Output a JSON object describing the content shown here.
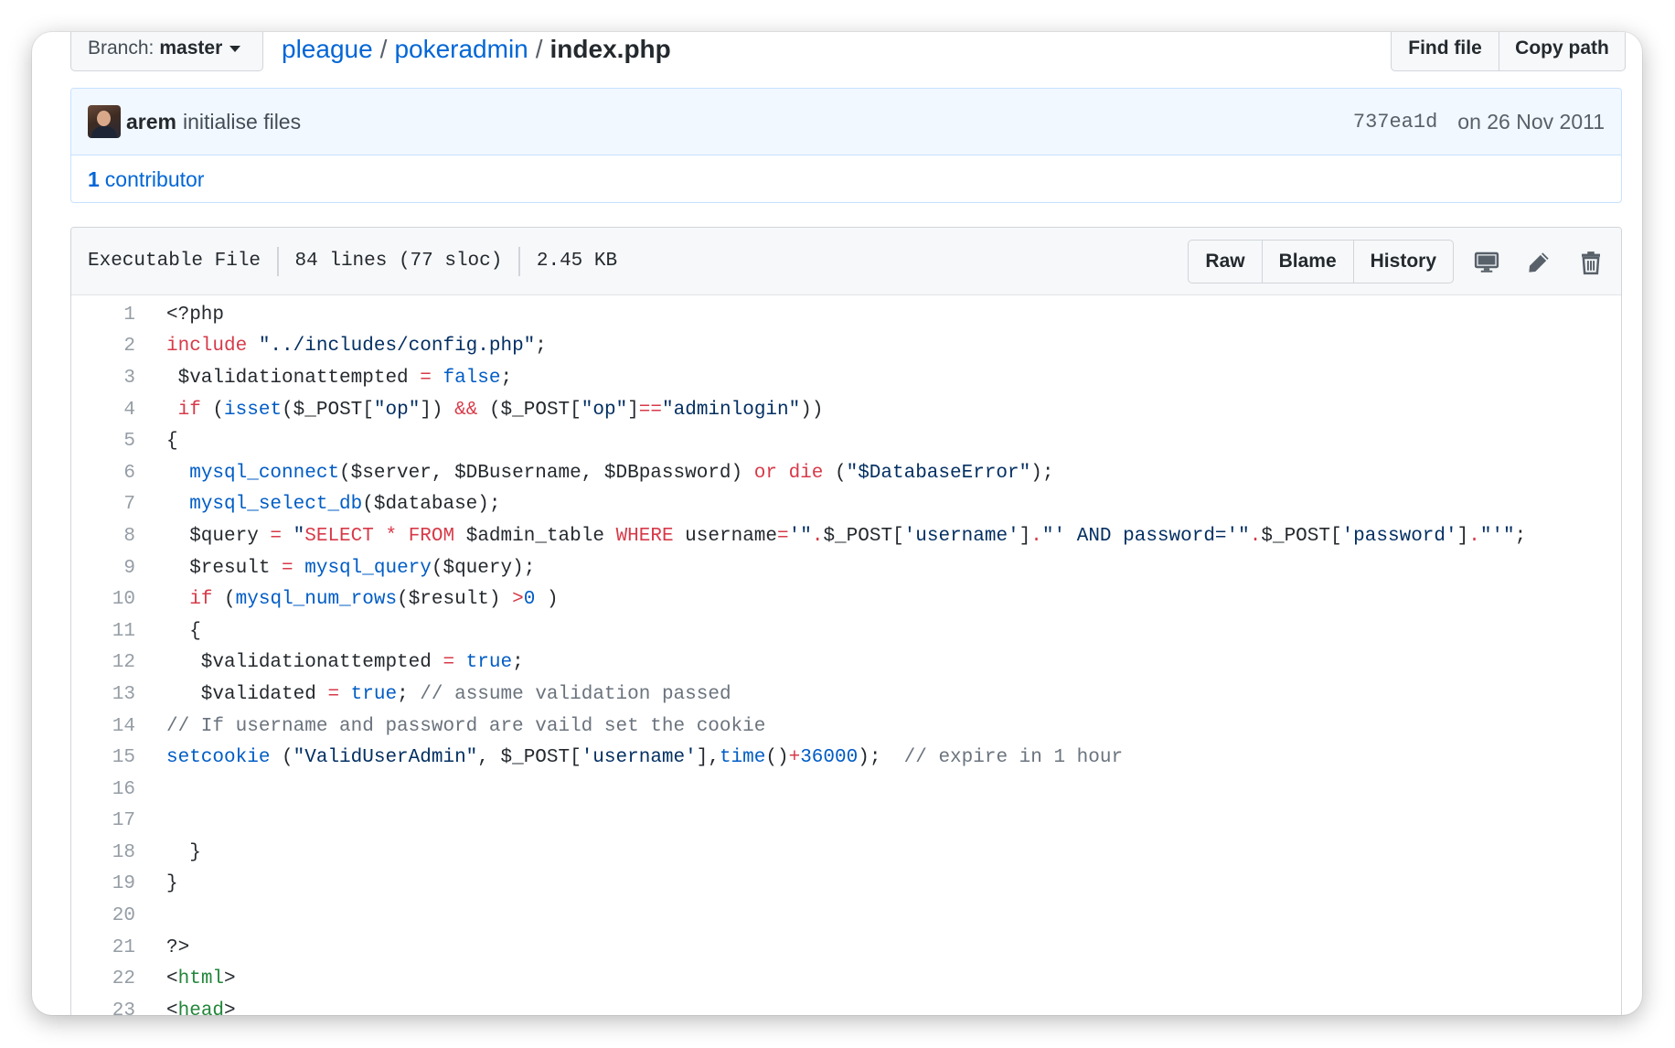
{
  "top": {
    "branch_label": "Branch:",
    "branch_value": "master",
    "breadcrumb_owner": "pleague",
    "breadcrumb_sep1": "/",
    "breadcrumb_repo": "pokeradmin",
    "breadcrumb_sep2": "/",
    "breadcrumb_file": "index.php",
    "find_file": "Find file",
    "copy_path": "Copy path"
  },
  "commit": {
    "author": "arem",
    "message": "initialise files",
    "sha": "737ea1d",
    "date": "on 26 Nov 2011",
    "contributors_count": "1",
    "contributors_label": "contributor"
  },
  "file": {
    "type": "Executable File",
    "lines": "84 lines (77 sloc)",
    "size": "2.45 KB",
    "raw": "Raw",
    "blame": "Blame",
    "history": "History",
    "icons": [
      "desktop-icon",
      "pencil-icon",
      "trash-icon"
    ]
  },
  "colors": {
    "keyword": "#d73a49",
    "entity": "#005cc5",
    "string": "#032f62",
    "comment": "#6a737d",
    "tag": "#22863a",
    "link": "#0366d6"
  },
  "code_lines": [
    {
      "n": "1",
      "tokens": [
        [
          "",
          "<?php"
        ]
      ]
    },
    {
      "n": "2",
      "tokens": [
        [
          "k",
          "include"
        ],
        [
          "",
          " "
        ],
        [
          "s",
          "\"../includes/config.php\""
        ],
        [
          "",
          ";"
        ]
      ]
    },
    {
      "n": "3",
      "tokens": [
        [
          "",
          " $validationattempted "
        ],
        [
          "k",
          "="
        ],
        [
          "",
          " "
        ],
        [
          "e",
          "false"
        ],
        [
          "",
          ";"
        ]
      ]
    },
    {
      "n": "4",
      "tokens": [
        [
          "",
          " "
        ],
        [
          "k",
          "if"
        ],
        [
          "",
          " ("
        ],
        [
          "e",
          "isset"
        ],
        [
          "",
          "($_POST["
        ],
        [
          "s",
          "\"op\""
        ],
        [
          "",
          "]) "
        ],
        [
          "k",
          "&&"
        ],
        [
          "",
          " ($_POST["
        ],
        [
          "s",
          "\"op\""
        ],
        [
          "",
          "]"
        ],
        [
          "k",
          "=="
        ],
        [
          "s",
          "\"adminlogin\""
        ],
        [
          "",
          "))"
        ]
      ]
    },
    {
      "n": "5",
      "tokens": [
        [
          "",
          "{"
        ]
      ]
    },
    {
      "n": "6",
      "tokens": [
        [
          "",
          "  "
        ],
        [
          "e",
          "mysql_connect"
        ],
        [
          "",
          "($server, $DBusername, $DBpassword) "
        ],
        [
          "k",
          "or"
        ],
        [
          "",
          " "
        ],
        [
          "k",
          "die"
        ],
        [
          "",
          " ("
        ],
        [
          "s",
          "\"$DatabaseError\""
        ],
        [
          "",
          ");"
        ]
      ]
    },
    {
      "n": "7",
      "tokens": [
        [
          "",
          "  "
        ],
        [
          "e",
          "mysql_select_db"
        ],
        [
          "",
          "($database);"
        ]
      ]
    },
    {
      "n": "8",
      "tokens": [
        [
          "",
          "  $query "
        ],
        [
          "k",
          "="
        ],
        [
          "",
          " "
        ],
        [
          "s",
          "\""
        ],
        [
          "k",
          "SELECT"
        ],
        [
          "",
          " "
        ],
        [
          "k",
          "*"
        ],
        [
          "",
          " "
        ],
        [
          "k",
          "FROM"
        ],
        [
          "",
          " $admin_table "
        ],
        [
          "k",
          "WHERE"
        ],
        [
          "",
          " username"
        ],
        [
          "k",
          "="
        ],
        [
          "s",
          "'\""
        ],
        [
          "k",
          "."
        ],
        [
          "",
          "$_POST["
        ],
        [
          "s",
          "'username'"
        ],
        [
          "",
          "]"
        ],
        [
          "k",
          "."
        ],
        [
          "s",
          "\"' AND password='\""
        ],
        [
          "k",
          "."
        ],
        [
          "",
          "$_POST["
        ],
        [
          "s",
          "'password'"
        ],
        [
          "",
          "]"
        ],
        [
          "k",
          "."
        ],
        [
          "s",
          "\"'\""
        ],
        [
          "",
          ";"
        ]
      ]
    },
    {
      "n": "9",
      "tokens": [
        [
          "",
          "  $result "
        ],
        [
          "k",
          "="
        ],
        [
          "",
          " "
        ],
        [
          "e",
          "mysql_query"
        ],
        [
          "",
          "($query);"
        ]
      ]
    },
    {
      "n": "10",
      "tokens": [
        [
          "",
          "  "
        ],
        [
          "k",
          "if"
        ],
        [
          "",
          " ("
        ],
        [
          "e",
          "mysql_num_rows"
        ],
        [
          "",
          "($result) "
        ],
        [
          "k",
          ">"
        ],
        [
          "e",
          "0"
        ],
        [
          "",
          " )"
        ]
      ]
    },
    {
      "n": "11",
      "tokens": [
        [
          "",
          "  {"
        ]
      ]
    },
    {
      "n": "12",
      "tokens": [
        [
          "",
          "   $validationattempted "
        ],
        [
          "k",
          "="
        ],
        [
          "",
          " "
        ],
        [
          "e",
          "true"
        ],
        [
          "",
          ";"
        ]
      ]
    },
    {
      "n": "13",
      "tokens": [
        [
          "",
          "   $validated "
        ],
        [
          "k",
          "="
        ],
        [
          "",
          " "
        ],
        [
          "e",
          "true"
        ],
        [
          "",
          "; "
        ],
        [
          "c",
          "// assume validation passed"
        ]
      ]
    },
    {
      "n": "14",
      "tokens": [
        [
          "c",
          "// If username and password are vaild set the cookie"
        ]
      ]
    },
    {
      "n": "15",
      "tokens": [
        [
          "e",
          "setcookie"
        ],
        [
          "",
          " ("
        ],
        [
          "s",
          "\"ValidUserAdmin\""
        ],
        [
          "",
          ", $_POST["
        ],
        [
          "s",
          "'username'"
        ],
        [
          "",
          "],"
        ],
        [
          "e",
          "time"
        ],
        [
          "",
          "()"
        ],
        [
          "k",
          "+"
        ],
        [
          "e",
          "36000"
        ],
        [
          "",
          ");  "
        ],
        [
          "c",
          "// expire in 1 hour"
        ]
      ]
    },
    {
      "n": "16",
      "tokens": [
        [
          "",
          ""
        ]
      ]
    },
    {
      "n": "17",
      "tokens": [
        [
          "",
          ""
        ]
      ]
    },
    {
      "n": "18",
      "tokens": [
        [
          "",
          "  }"
        ]
      ]
    },
    {
      "n": "19",
      "tokens": [
        [
          "",
          "}"
        ]
      ]
    },
    {
      "n": "20",
      "tokens": [
        [
          "",
          ""
        ]
      ]
    },
    {
      "n": "21",
      "tokens": [
        [
          "",
          "?>"
        ]
      ]
    },
    {
      "n": "22",
      "tokens": [
        [
          "",
          "<"
        ],
        [
          "t",
          "html"
        ],
        [
          "",
          ">"
        ]
      ]
    },
    {
      "n": "23",
      "tokens": [
        [
          "",
          "<"
        ],
        [
          "t",
          "head"
        ],
        [
          "",
          ">"
        ]
      ]
    }
  ]
}
